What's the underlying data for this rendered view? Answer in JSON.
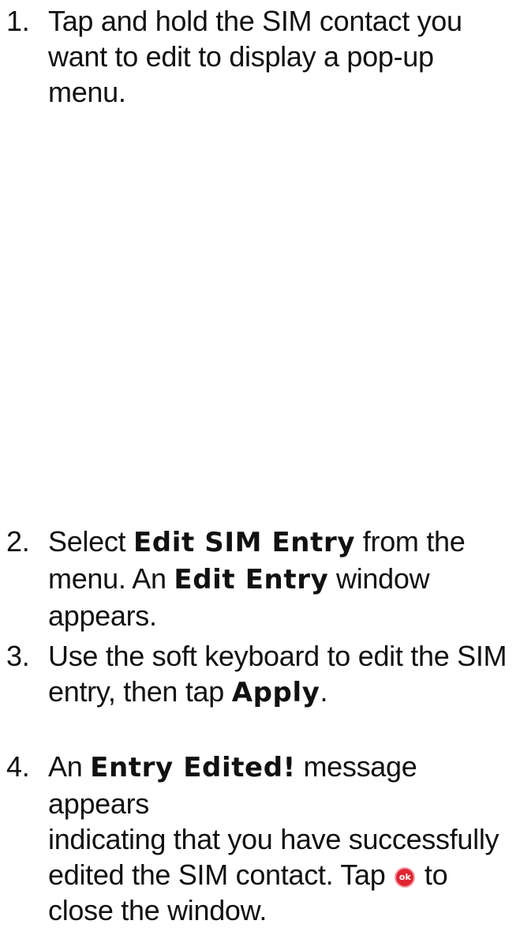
{
  "steps": [
    {
      "num": "1.",
      "lines": [
        "Tap and hold the SIM contact you",
        "want to edit to display a pop-up",
        "menu."
      ]
    },
    {
      "num": "2.",
      "l1_pre": "Select ",
      "l1_kw": "Edit SIM Entry",
      "l1_post": " from the",
      "l2_pre": "menu. An ",
      "l2_kw": "Edit Entry",
      "l2_post": " window",
      "l3": "appears."
    },
    {
      "num": "3.",
      "l1": "Use the soft keyboard to edit the SIM",
      "l2_pre": "entry, then tap ",
      "l2_kw": "Apply",
      "l2_post": "."
    },
    {
      "num": "4.",
      "l1_pre": "An ",
      "l1_kw": "Entry Edited!",
      "l1_post": " message appears",
      "l2": "indicating that you have successfully",
      "l3_pre": "edited the SIM contact. Tap ",
      "l3_icon": "ok",
      "l3_post": " to",
      "l4": "close the window."
    }
  ],
  "icons": {
    "ok_icon": "ok-button-icon",
    "ok_color": "#e02432"
  }
}
